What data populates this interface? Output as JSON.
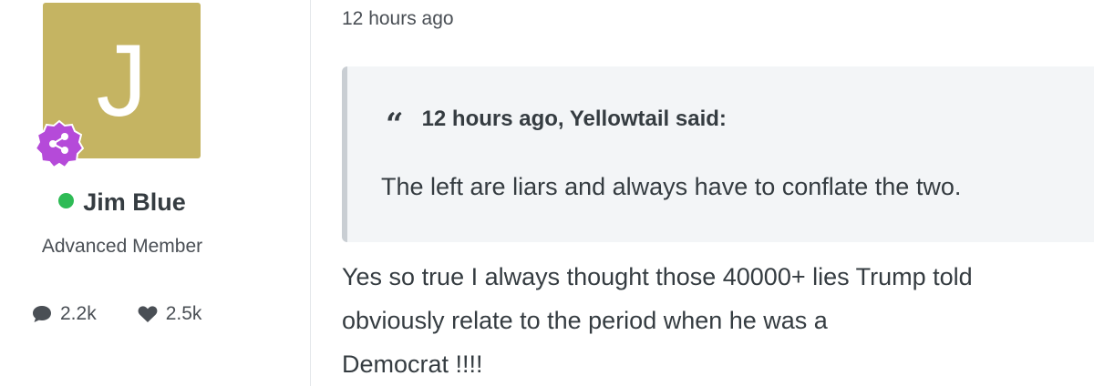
{
  "author": {
    "avatar_letter": "J",
    "avatar_color": "#c5b462",
    "badge_icon": "share-nodes-icon",
    "badge_color": "#b54ad9",
    "online_status_color": "#2ebb55",
    "name": "Jim Blue",
    "rank": "Advanced Member",
    "stats": {
      "posts": "2.2k",
      "reputation": "2.5k"
    }
  },
  "post": {
    "timestamp": "12 hours ago",
    "quote": {
      "citation": "12 hours ago, Yellowtail said:",
      "text": "The left are liars and always have to conflate the two."
    },
    "body_lines": [
      "Yes so true I always thought those 40000+ lies Trump told",
      "obviously relate to the period when he was a",
      "Democrat !!!!"
    ]
  }
}
